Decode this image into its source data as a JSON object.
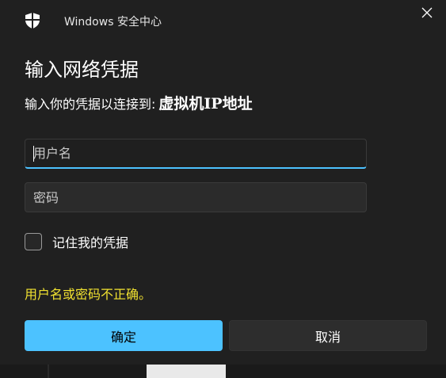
{
  "window": {
    "app_title": "Windows 安全中心",
    "app_icon": "shield-icon",
    "close_icon": "close-icon"
  },
  "dialog": {
    "heading": "输入网络凭据",
    "subtitle_prefix": "输入你的凭据以连接到:",
    "subtitle_target": "虚拟机IP地址"
  },
  "fields": {
    "username": {
      "value": "",
      "placeholder": "用户名"
    },
    "password": {
      "value": "",
      "placeholder": "密码"
    }
  },
  "remember": {
    "label": "记住我的凭据",
    "checked": false
  },
  "error": {
    "message": "用户名或密码不正确。"
  },
  "buttons": {
    "ok_label": "确定",
    "cancel_label": "取消"
  },
  "colors": {
    "accent": "#4cc2ff",
    "error": "#f0e130",
    "background": "#202020"
  }
}
